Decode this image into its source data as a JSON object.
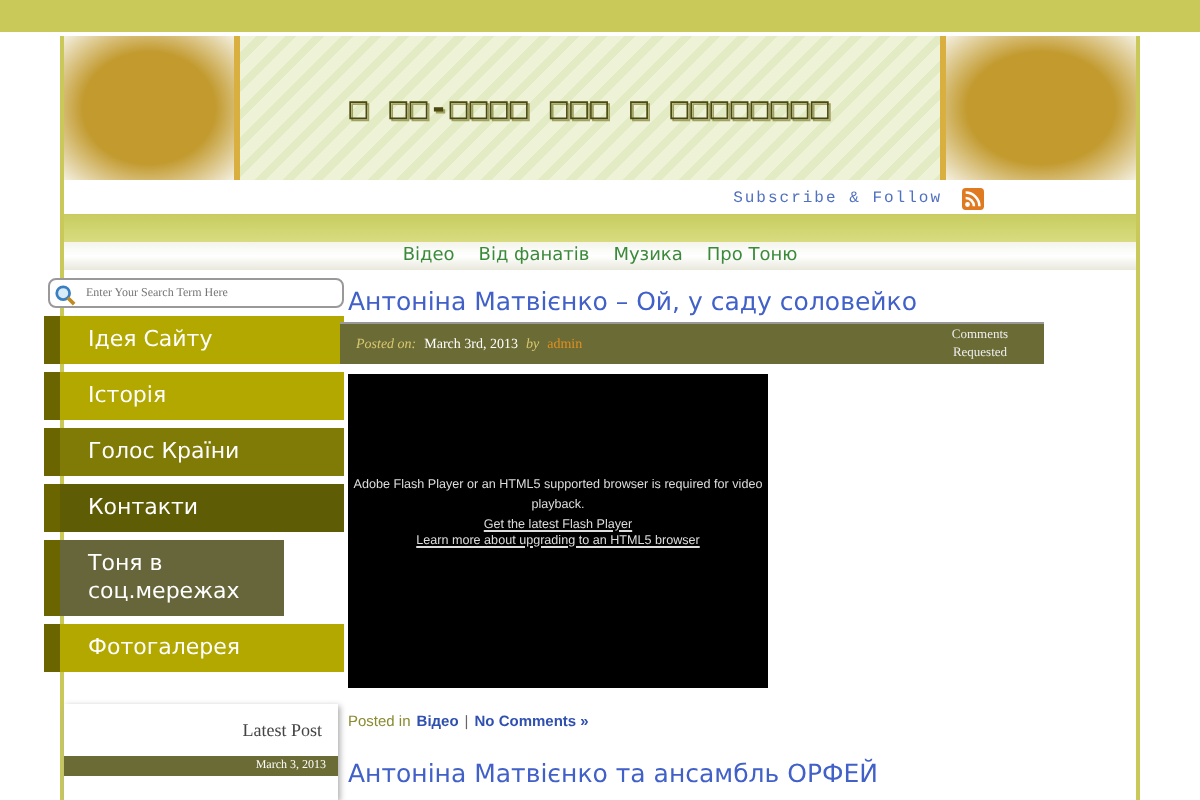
{
  "header": {
    "site_title": "□ □□-□□□□ □□□ □ □□□□□□□□",
    "subscribe": "Subscribe & Follow"
  },
  "nav": {
    "items": [
      {
        "label": "Відео"
      },
      {
        "label": "Від фанатів"
      },
      {
        "label": "Музика"
      },
      {
        "label": "Про Тоню"
      }
    ]
  },
  "sidebar": {
    "search": {
      "placeholder": "Enter Your Search Term Here"
    },
    "menu": [
      {
        "label": "Ідея Сайту",
        "color": "#b2a800"
      },
      {
        "label": "Історія",
        "color": "#b2a800"
      },
      {
        "label": "Голос Країни",
        "color": "#807a06"
      },
      {
        "label": "Контакти",
        "color": "#5e5c05"
      },
      {
        "label": "Тоня в соц.мережах",
        "color": "#66663a"
      },
      {
        "label": "Фотогалерея",
        "color": "#b2a800"
      }
    ],
    "latest": {
      "title": "Latest Post",
      "date": "March 3, 2013"
    }
  },
  "posts": [
    {
      "title": "Антоніна Матвієнко – Ой, у саду соловейко",
      "posted_label": "Posted on:",
      "date": "March 3rd, 2013",
      "by": "by",
      "author": "admin",
      "comments": "Comments Requested",
      "video": {
        "message": "Adobe Flash Player or an HTML5 supported browser is required for video playback.",
        "link_1": "Get the latest Flash Player",
        "link_2": "Learn more about upgrading to an HTML5 browser"
      },
      "footer": {
        "posted_in": "Posted in",
        "category": "Відео",
        "separator": "|",
        "comments_link": "No Comments »"
      }
    },
    {
      "title": "Антоніна Матвієнко та ансамбль ОРФЕЙ"
    }
  ]
}
